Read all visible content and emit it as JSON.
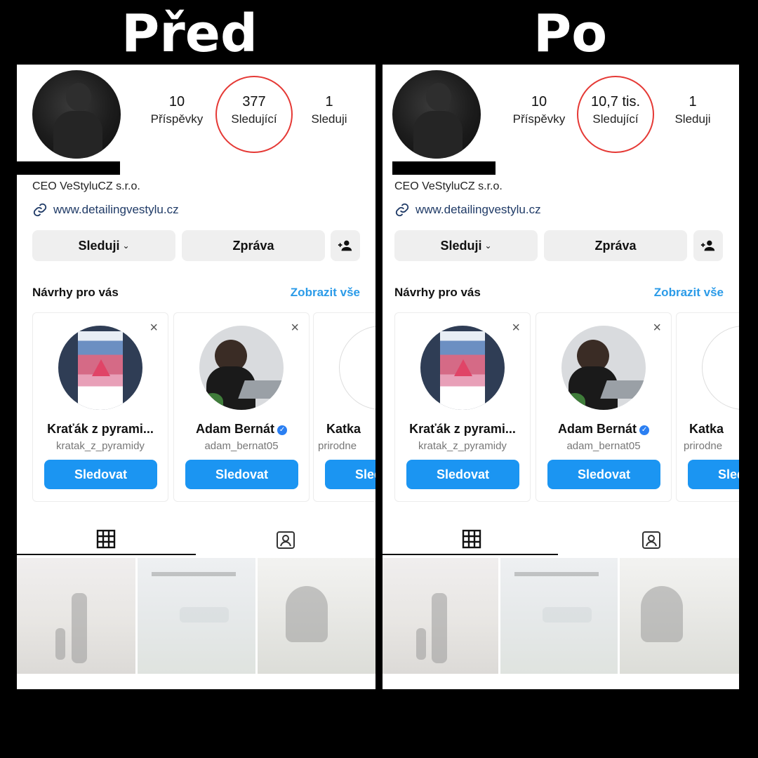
{
  "headings": {
    "left": "Před",
    "right": "Po"
  },
  "panels": {
    "before": {
      "stats": [
        {
          "value": "10",
          "label": "Příspěvky"
        },
        {
          "value": "377",
          "label": "Sledující"
        },
        {
          "value": "1",
          "label": "Sleduji"
        }
      ]
    },
    "after": {
      "stats": [
        {
          "value": "10",
          "label": "Příspěvky"
        },
        {
          "value": "10,7 tis.",
          "label": "Sledující"
        },
        {
          "value": "1",
          "label": "Sleduji"
        }
      ]
    }
  },
  "profile": {
    "bio": "CEO VeStyluCZ s.r.o.",
    "link": "www.detailingvestylu.cz",
    "follow_button": "Sleduji",
    "message_button": "Zpráva"
  },
  "suggestions": {
    "title": "Návrhy pro vás",
    "see_all": "Zobrazit vše",
    "close_glyph": "×",
    "cards": [
      {
        "name": "Kraťák z pyrami...",
        "username": "kratak_z_pyramidy",
        "button": "Sledovat"
      },
      {
        "name": "Adam Bernát",
        "username": "adam_bernat05",
        "button": "Sledovat",
        "verified": true
      },
      {
        "name": "Katka",
        "username": "prirodne",
        "button": "Sledovat"
      }
    ]
  },
  "colors": {
    "accent_blue": "#1b95f2",
    "highlight_red": "#e53935",
    "link_blue": "#2b9be8"
  }
}
